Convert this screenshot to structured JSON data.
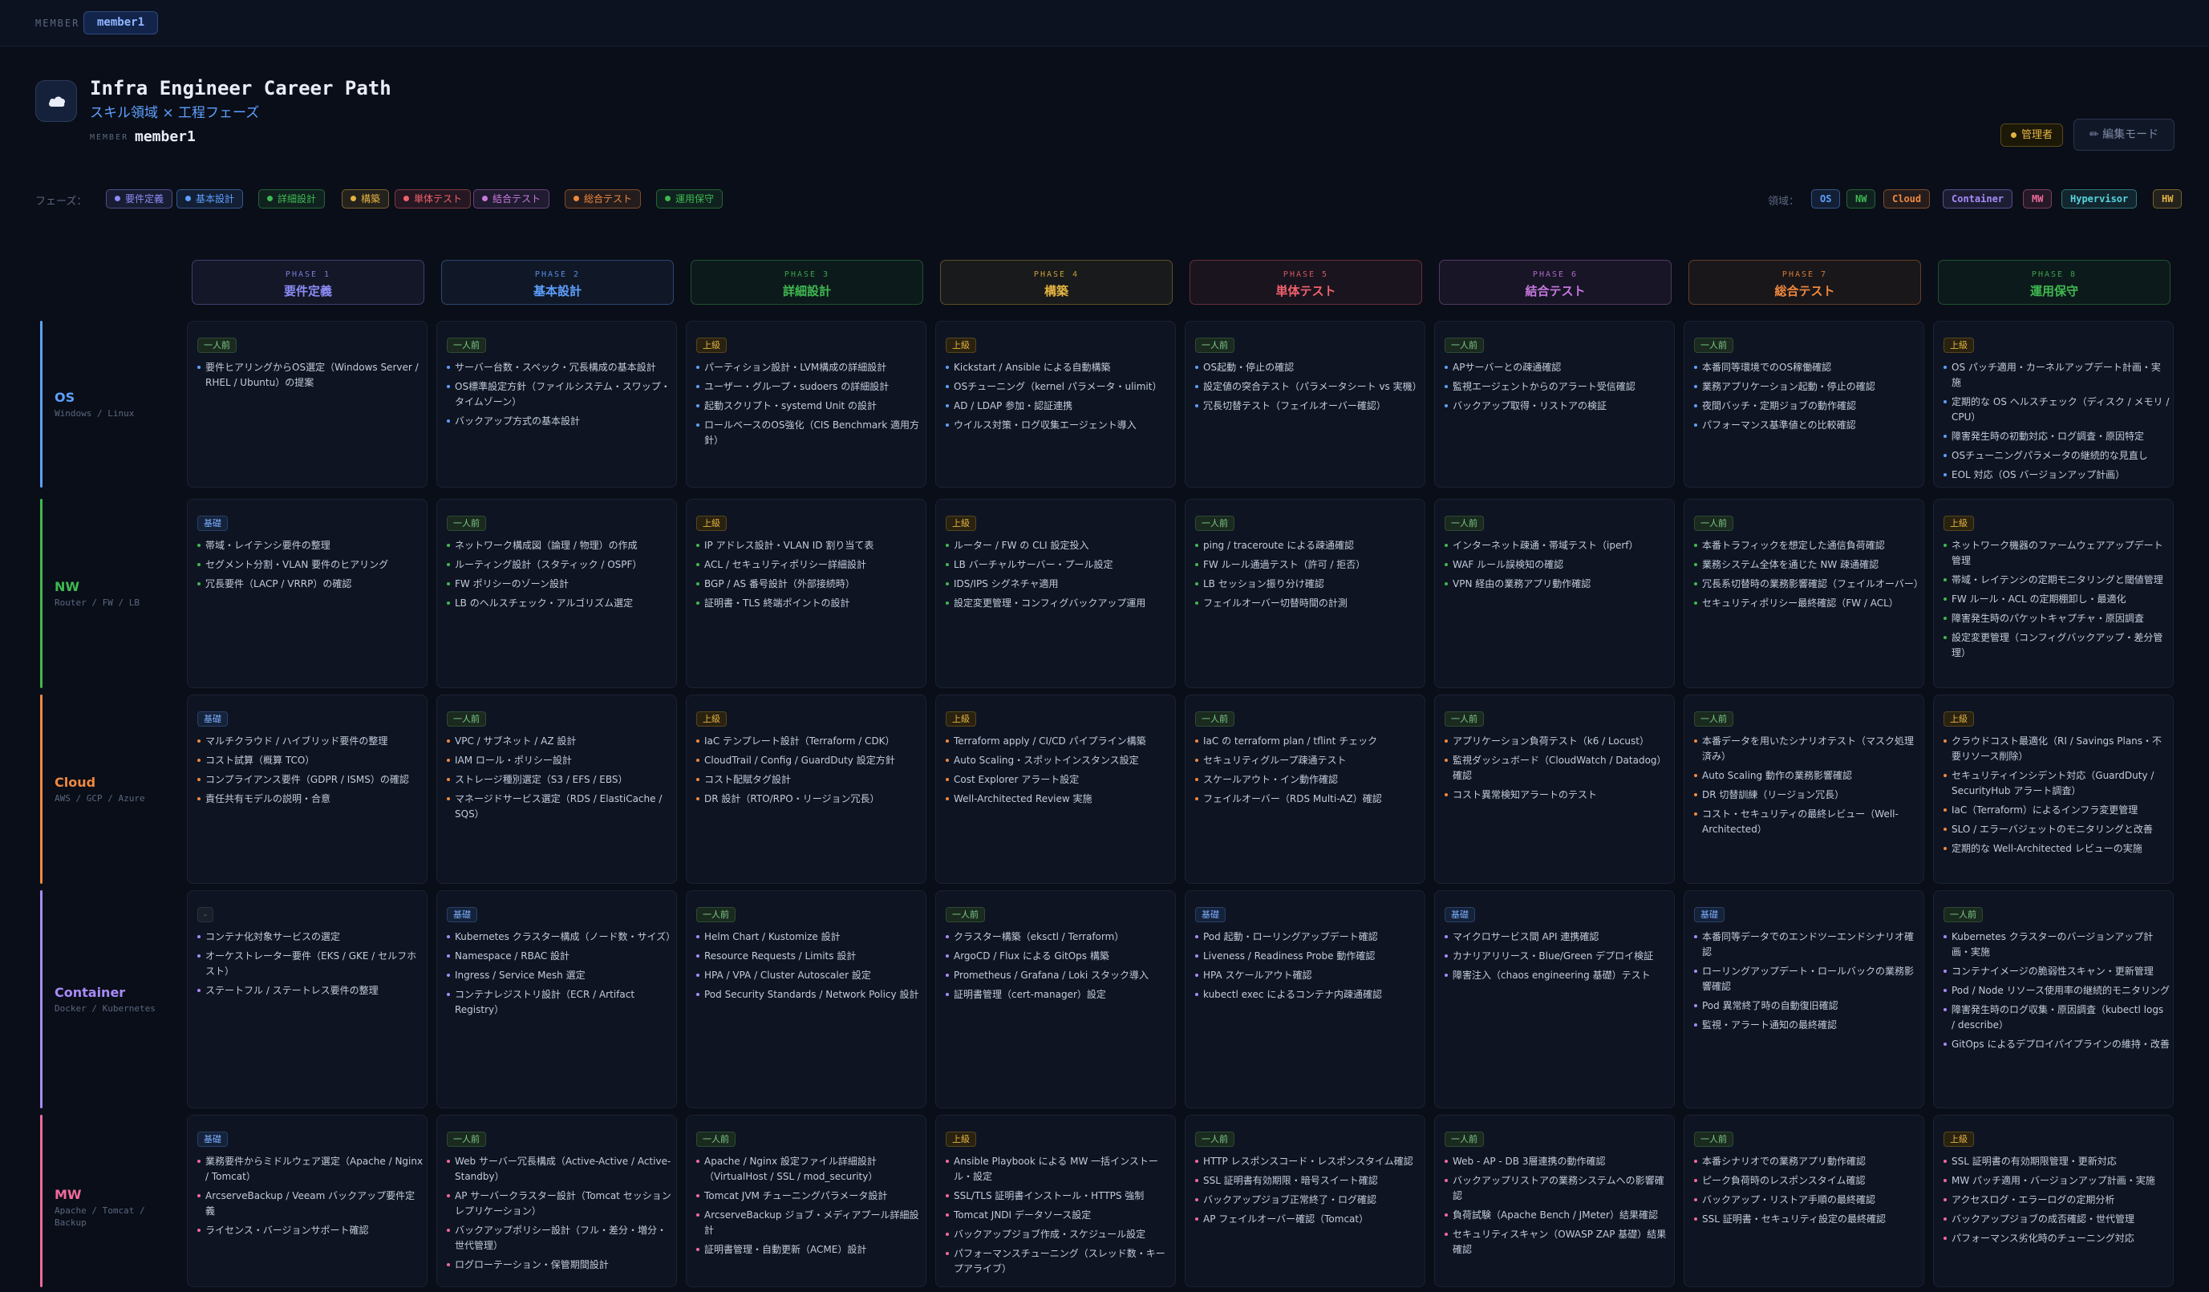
{
  "topbar": {
    "label": "MEMBER",
    "member": "member1"
  },
  "header": {
    "title": "Infra Engineer Career Path",
    "subtitle": "スキル領域 × 工程フェーズ",
    "member_label": "MEMBER",
    "member_value": "member1",
    "admin_badge": "管理者",
    "edit_button": "✏ 編集モード"
  },
  "filters": {
    "phase_label": "フェーズ：",
    "phases": [
      "要件定義",
      "基本設計",
      "詳細設計",
      "構築",
      "単体テスト",
      "結合テスト",
      "総合テスト",
      "運用保守"
    ],
    "domain_label": "領域：",
    "domains": [
      "OS",
      "NW",
      "Cloud",
      "Container",
      "MW",
      "Hypervisor",
      "HW"
    ]
  },
  "colors": {
    "phases": [
      "#8b8cf5",
      "#5ea0ff",
      "#3fb950",
      "#e3b341",
      "#f0616d",
      "#c678dd",
      "#f0883e",
      "#3fb950"
    ],
    "domains": [
      "#5ea0ff",
      "#3fb950",
      "#f0883e",
      "#a78bfa",
      "#f06a9c",
      "#56d4dd",
      "#e3b341"
    ]
  },
  "phase_headers": [
    {
      "num": "PHASE 1",
      "name": "要件定義"
    },
    {
      "num": "PHASE 2",
      "name": "基本設計"
    },
    {
      "num": "PHASE 3",
      "name": "詳細設計"
    },
    {
      "num": "PHASE 4",
      "name": "構築"
    },
    {
      "num": "PHASE 5",
      "name": "単体テスト"
    },
    {
      "num": "PHASE 6",
      "name": "結合テスト"
    },
    {
      "num": "PHASE 7",
      "name": "総合テスト"
    },
    {
      "num": "PHASE 8",
      "name": "運用保守"
    }
  ],
  "rows": [
    {
      "name": "OS",
      "sub": "Windows / Linux",
      "cells": [
        {
          "level": "一人前",
          "items": [
            "要件ヒアリングからOS選定（Windows Server / RHEL / Ubuntu）の提案"
          ]
        },
        {
          "level": "一人前",
          "items": [
            "サーバー台数・スペック・冗長構成の基本設計",
            "OS標準設定方針（ファイルシステム・スワップ・タイムゾーン）",
            "バックアップ方式の基本設計"
          ]
        },
        {
          "level": "上級",
          "items": [
            "パーティション設計・LVM構成の詳細設計",
            "ユーザー・グループ・sudoers の詳細設計",
            "起動スクリプト・systemd Unit の設計",
            "ロールベースのOS強化（CIS Benchmark 適用方針）"
          ]
        },
        {
          "level": "上級",
          "items": [
            "Kickstart / Ansible による自動構築",
            "OSチューニング（kernel パラメータ・ulimit）",
            "AD / LDAP 参加・認証連携",
            "ウイルス対策・ログ収集エージェント導入"
          ]
        },
        {
          "level": "一人前",
          "items": [
            "OS起動・停止の確認",
            "設定値の突合テスト（パラメータシート vs 実機）",
            "冗長切替テスト（フェイルオーバー確認）"
          ]
        },
        {
          "level": "一人前",
          "items": [
            "APサーバーとの疎通確認",
            "監視エージェントからのアラート受信確認",
            "バックアップ取得・リストアの検証"
          ]
        },
        {
          "level": "一人前",
          "items": [
            "本番同等環境でのOS稼働確認",
            "業務アプリケーション起動・停止の確認",
            "夜間バッチ・定期ジョブの動作確認",
            "パフォーマンス基準値との比較確認"
          ]
        },
        {
          "level": "上級",
          "items": [
            "OS パッチ適用・カーネルアップデート計画・実施",
            "定期的な OS ヘルスチェック（ディスク / メモリ / CPU）",
            "障害発生時の初動対応・ログ調査・原因特定",
            "OSチューニングパラメータの継続的な見直し",
            "EOL 対応（OS バージョンアップ計画）"
          ]
        }
      ]
    },
    {
      "name": "NW",
      "sub": "Router / FW / LB",
      "cells": [
        {
          "level": "基礎",
          "items": [
            "帯域・レイテンシ要件の整理",
            "セグメント分割・VLAN 要件のヒアリング",
            "冗長要件（LACP / VRRP）の確認"
          ]
        },
        {
          "level": "一人前",
          "items": [
            "ネットワーク構成図（論理 / 物理）の作成",
            "ルーティング設計（スタティック / OSPF）",
            "FW ポリシーのゾーン設計",
            "LB のヘルスチェック・アルゴリズム選定"
          ]
        },
        {
          "level": "上級",
          "items": [
            "IP アドレス設計・VLAN ID 割り当て表",
            "ACL / セキュリティポリシー詳細設計",
            "BGP / AS 番号設計（外部接続時）",
            "証明書・TLS 終端ポイントの設計"
          ]
        },
        {
          "level": "上級",
          "items": [
            "ルーター / FW の CLI 設定投入",
            "LB バーチャルサーバー・プール設定",
            "IDS/IPS シグネチャ適用",
            "設定変更管理・コンフィグバックアップ運用"
          ]
        },
        {
          "level": "一人前",
          "items": [
            "ping / traceroute による疎通確認",
            "FW ルール通過テスト（許可 / 拒否）",
            "LB セッション振り分け確認",
            "フェイルオーバー切替時間の計測"
          ]
        },
        {
          "level": "一人前",
          "items": [
            "インターネット疎通・帯域テスト（iperf）",
            "WAF ルール誤検知の確認",
            "VPN 経由の業務アプリ動作確認"
          ]
        },
        {
          "level": "一人前",
          "items": [
            "本番トラフィックを想定した通信負荷確認",
            "業務システム全体を通じた NW 疎通確認",
            "冗長系切替時の業務影響確認（フェイルオーバー）",
            "セキュリティポリシー最終確認（FW / ACL）"
          ]
        },
        {
          "level": "上級",
          "items": [
            "ネットワーク機器のファームウェアアップデート管理",
            "帯域・レイテンシの定期モニタリングと閾値管理",
            "FW ルール・ACL の定期棚卸し・最適化",
            "障害発生時のパケットキャプチャ・原因調査",
            "設定変更管理（コンフィグバックアップ・差分管理）"
          ]
        }
      ]
    },
    {
      "name": "Cloud",
      "sub": "AWS / GCP / Azure",
      "cells": [
        {
          "level": "基礎",
          "items": [
            "マルチクラウド / ハイブリッド要件の整理",
            "コスト試算（概算 TCO）",
            "コンプライアンス要件（GDPR / ISMS）の確認",
            "責任共有モデルの説明・合意"
          ]
        },
        {
          "level": "一人前",
          "items": [
            "VPC / サブネット / AZ 設計",
            "IAM ロール・ポリシー設計",
            "ストレージ種別選定（S3 / EFS / EBS）",
            "マネージドサービス選定（RDS / ElastiCache / SQS）"
          ]
        },
        {
          "level": "上級",
          "items": [
            "IaC テンプレート設計（Terraform / CDK）",
            "CloudTrail / Config / GuardDuty 設定方針",
            "コスト配賦タグ設計",
            "DR 設計（RTO/RPO・リージョン冗長）"
          ]
        },
        {
          "level": "上級",
          "items": [
            "Terraform apply / CI/CD パイプライン構築",
            "Auto Scaling・スポットインスタンス設定",
            "Cost Explorer アラート設定",
            "Well-Architected Review 実施"
          ]
        },
        {
          "level": "一人前",
          "items": [
            "IaC の terraform plan / tflint チェック",
            "セキュリティグループ疎通テスト",
            "スケールアウト・イン動作確認",
            "フェイルオーバー（RDS Multi-AZ）確認"
          ]
        },
        {
          "level": "一人前",
          "items": [
            "アプリケーション負荷テスト（k6 / Locust）",
            "監視ダッシュボード（CloudWatch / Datadog）確認",
            "コスト異常検知アラートのテスト"
          ]
        },
        {
          "level": "一人前",
          "items": [
            "本番データを用いたシナリオテスト（マスク処理済み）",
            "Auto Scaling 動作の業務影響確認",
            "DR 切替訓練（リージョン冗長）",
            "コスト・セキュリティの最終レビュー（Well-Architected）"
          ]
        },
        {
          "level": "上級",
          "items": [
            "クラウドコスト最適化（RI / Savings Plans・不要リソース削除）",
            "セキュリティインシデント対応（GuardDuty / SecurityHub アラート調査）",
            "IaC（Terraform）によるインフラ変更管理",
            "SLO / エラーバジェットのモニタリングと改善",
            "定期的な Well-Architected レビューの実施"
          ]
        }
      ]
    },
    {
      "name": "Container",
      "sub": "Docker / Kubernetes",
      "cells": [
        {
          "level": "-",
          "items": [
            "コンテナ化対象サービスの選定",
            "オーケストレーター要件（EKS / GKE / セルフホスト）",
            "ステートフル / ステートレス要件の整理"
          ]
        },
        {
          "level": "基礎",
          "items": [
            "Kubernetes クラスター構成（ノード数・サイズ）",
            "Namespace / RBAC 設計",
            "Ingress / Service Mesh 選定",
            "コンテナレジストリ設計（ECR / Artifact Registry）"
          ]
        },
        {
          "level": "一人前",
          "items": [
            "Helm Chart / Kustomize 設計",
            "Resource Requests / Limits 設計",
            "HPA / VPA / Cluster Autoscaler 設定",
            "Pod Security Standards / Network Policy 設計"
          ]
        },
        {
          "level": "一人前",
          "items": [
            "クラスター構築（eksctl / Terraform）",
            "ArgoCD / Flux による GitOps 構築",
            "Prometheus / Grafana / Loki スタック導入",
            "証明書管理（cert-manager）設定"
          ]
        },
        {
          "level": "基礎",
          "items": [
            "Pod 起動・ローリングアップデート確認",
            "Liveness / Readiness Probe 動作確認",
            "HPA スケールアウト確認",
            "kubectl exec によるコンテナ内疎通確認"
          ]
        },
        {
          "level": "基礎",
          "items": [
            "マイクロサービス間 API 連携確認",
            "カナリアリリース・Blue/Green デプロイ検証",
            "障害注入（chaos engineering 基礎）テスト"
          ]
        },
        {
          "level": "基礎",
          "items": [
            "本番同等データでのエンドツーエンドシナリオ確認",
            "ローリングアップデート・ロールバックの業務影響確認",
            "Pod 異常終了時の自動復旧確認",
            "監視・アラート通知の最終確認"
          ]
        },
        {
          "level": "一人前",
          "items": [
            "Kubernetes クラスターのバージョンアップ計画・実施",
            "コンテナイメージの脆弱性スキャン・更新管理",
            "Pod / Node リソース使用率の継続的モニタリング",
            "障害発生時のログ収集・原因調査（kubectl logs / describe）",
            "GitOps によるデプロイパイプラインの維持・改善"
          ]
        }
      ]
    },
    {
      "name": "MW",
      "sub": "Apache / Tomcat / Backup",
      "cells": [
        {
          "level": "基礎",
          "items": [
            "業務要件からミドルウェア選定（Apache / Nginx / Tomcat）",
            "ArcserveBackup / Veeam バックアップ要件定義",
            "ライセンス・バージョンサポート確認"
          ]
        },
        {
          "level": "一人前",
          "items": [
            "Web サーバー冗長構成（Active-Active / Active-Standby）",
            "AP サーバークラスター設計（Tomcat セッションレプリケーション）",
            "バックアップポリシー設計（フル・差分・増分・世代管理）",
            "ログローテーション・保管期間設計"
          ]
        },
        {
          "level": "一人前",
          "items": [
            "Apache / Nginx 設定ファイル詳細設計（VirtualHost / SSL / mod_security）",
            "Tomcat JVM チューニングパラメータ設計",
            "ArcserveBackup ジョブ・メディアプール詳細設計",
            "証明書管理・自動更新（ACME）設計"
          ]
        },
        {
          "level": "上級",
          "items": [
            "Ansible Playbook による MW 一括インストール・設定",
            "SSL/TLS 証明書インストール・HTTPS 強制",
            "Tomcat JNDI データソース設定",
            "バックアップジョブ作成・スケジュール設定",
            "パフォーマンスチューニング（スレッド数・キープアライブ）"
          ]
        },
        {
          "level": "一人前",
          "items": [
            "HTTP レスポンスコード・レスポンスタイム確認",
            "SSL 証明書有効期限・暗号スイート確認",
            "バックアップジョブ正常終了・ログ確認",
            "AP フェイルオーバー確認（Tomcat）"
          ]
        },
        {
          "level": "一人前",
          "items": [
            "Web - AP - DB 3層連携の動作確認",
            "バックアップリストアの業務システムへの影響確認",
            "負荷試験（Apache Bench / JMeter）結果確認",
            "セキュリティスキャン（OWASP ZAP 基礎）結果確認"
          ]
        },
        {
          "level": "一人前",
          "items": [
            "本番シナリオでの業務アプリ動作確認",
            "ピーク負荷時のレスポンスタイム確認",
            "バックアップ・リストア手順の最終確認",
            "SSL 証明書・セキュリティ設定の最終確認"
          ]
        },
        {
          "level": "上級",
          "items": [
            "SSL 証明書の有効期限管理・更新対応",
            "MW パッチ適用・バージョンアップ計画・実施",
            "アクセスログ・エラーログの定期分析",
            "バックアップジョブの成否確認・世代管理",
            "パフォーマンス劣化時のチューニング対応"
          ]
        }
      ]
    }
  ]
}
